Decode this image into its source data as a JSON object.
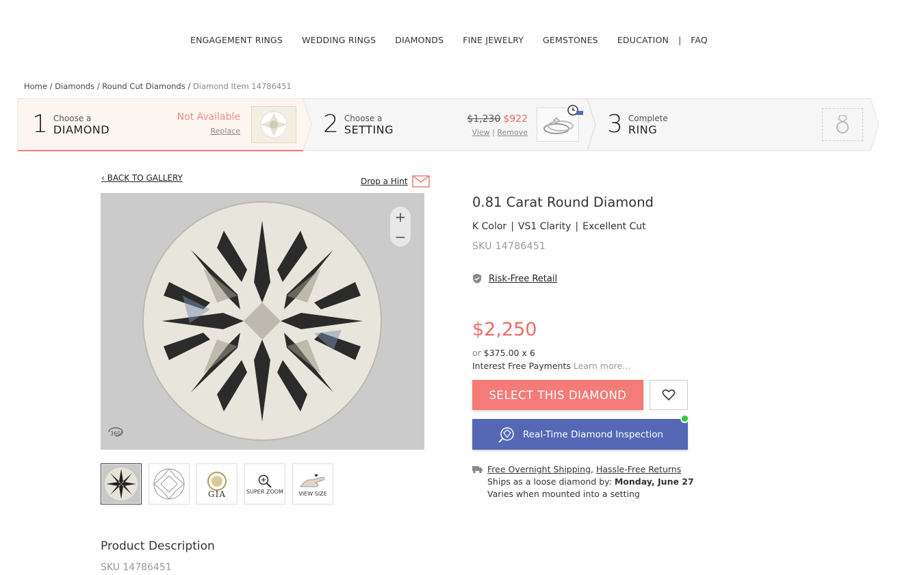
{
  "nav": {
    "items": [
      "ENGAGEMENT RINGS",
      "WEDDING RINGS",
      "DIAMONDS",
      "FINE JEWELRY",
      "GEMSTONES",
      "EDUCATION"
    ],
    "separator": "|",
    "faq": "FAQ"
  },
  "breadcrumb": {
    "home": "Home",
    "diamonds": "Diamonds",
    "round": "Round Cut Diamonds",
    "current": "Diamond Item 14786451",
    "sep": " / "
  },
  "steps": {
    "s1": {
      "num": "1",
      "small": "Choose a",
      "big": "DIAMOND",
      "status": "Not Available",
      "link": "Replace"
    },
    "s2": {
      "num": "2",
      "small": "Choose a",
      "big": "SETTING",
      "old_price": "$1,230",
      "new_price": "$922",
      "view": "View",
      "remove": "Remove",
      "link_sep": "|"
    },
    "s3": {
      "num": "3",
      "small": "Complete",
      "big": "RING"
    }
  },
  "gallery": {
    "back": "BACK TO GALLERY",
    "back_icon": "chevron-left-icon",
    "hint": "Drop a Hint",
    "zoom_in": "+",
    "zoom_out": "−",
    "badge": "360°",
    "thumbs": [
      {
        "name": "diamond-photo",
        "caption": ""
      },
      {
        "name": "diamond-diagram",
        "caption": ""
      },
      {
        "name": "gia-certificate",
        "caption": "GIA"
      },
      {
        "name": "super-zoom",
        "caption": "SUPER ZOOM"
      },
      {
        "name": "view-size",
        "caption": "VIEW SIZE"
      }
    ]
  },
  "product": {
    "title": "0.81 Carat Round Diamond",
    "color": "K Color",
    "clarity": "VS1 Clarity",
    "cut": "Excellent Cut",
    "spec_sep": "|",
    "sku": "SKU 14786451",
    "risk": "Risk-Free Retail",
    "price": "$2,250",
    "install_or": "or",
    "install_amount": "$375.00 x 6",
    "interest": "Interest Free Payments",
    "learn_more": "Learn more...",
    "select_button": "SELECT THIS DIAMOND",
    "inspection_button": "Real-Time Diamond Inspection",
    "shipping_free": "Free Overnight Shipping",
    "shipping_comma": ",",
    "shipping_returns": "Hassle-Free Returns",
    "ships_text": "Ships as a loose diamond by:",
    "ships_date": "Monday, June 27",
    "varies": "Varies when mounted into a setting"
  },
  "description": {
    "heading": "Product Description",
    "sku": "SKU 14786451"
  },
  "colors": {
    "accent": "#f47b77",
    "price": "#f06b66",
    "inspect": "#5468b5",
    "online": "#2ecc40"
  }
}
